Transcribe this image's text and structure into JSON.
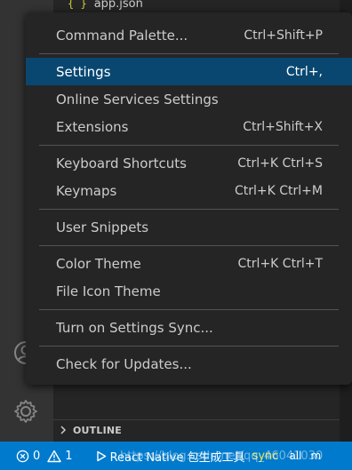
{
  "explorer": {
    "file_name": "app.json",
    "file_icon": "{ }"
  },
  "outline": {
    "title": "OUTLINE"
  },
  "menu": {
    "items": [
      {
        "label": "Command Palette...",
        "shortcut": "Ctrl+Shift+P"
      },
      {
        "label": "Settings",
        "shortcut": "Ctrl+,"
      },
      {
        "label": "Online Services Settings",
        "shortcut": ""
      },
      {
        "label": "Extensions",
        "shortcut": "Ctrl+Shift+X"
      },
      {
        "label": "Keyboard Shortcuts",
        "shortcut": "Ctrl+K Ctrl+S"
      },
      {
        "label": "Keymaps",
        "shortcut": "Ctrl+K Ctrl+M"
      },
      {
        "label": "User Snippets",
        "shortcut": ""
      },
      {
        "label": "Color Theme",
        "shortcut": "Ctrl+K Ctrl+T"
      },
      {
        "label": "File Icon Theme",
        "shortcut": ""
      },
      {
        "label": "Turn on Settings Sync...",
        "shortcut": ""
      },
      {
        "label": "Check for Updates...",
        "shortcut": ""
      }
    ],
    "selected_index": 1
  },
  "status_bar": {
    "errors": "0",
    "warnings": "1",
    "task": "React Native 包生成工具",
    "sync": "sync",
    "all": "all",
    "extra": "m",
    "watermark": "https://blog.csdn.net/qq_46041030"
  },
  "colors": {
    "accent": "#007acc",
    "selection": "#094771"
  }
}
